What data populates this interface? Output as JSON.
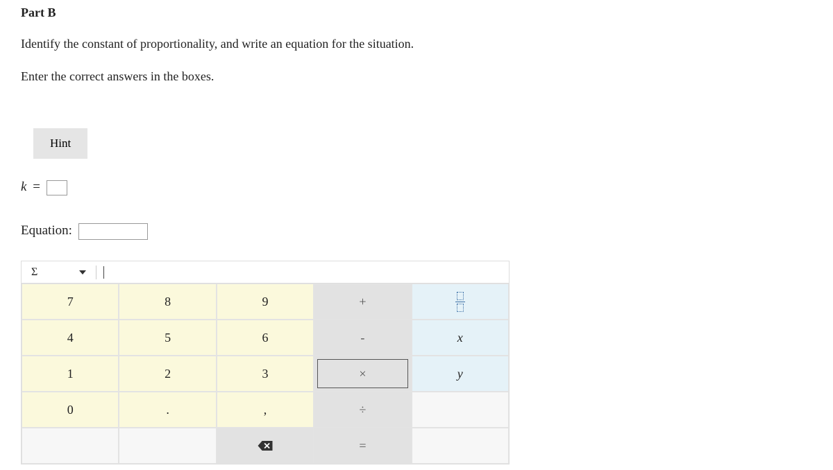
{
  "part_title": "Part B",
  "instruction1": "Identify the constant of proportionality, and write an equation for the situation.",
  "instruction2": "Enter the correct answers in the boxes.",
  "hint_label": "Hint",
  "k_row": {
    "var": "k",
    "eq": "="
  },
  "equation_label": "Equation:",
  "toolbar": {
    "sigma": "Σ"
  },
  "keys": {
    "r1": {
      "c1": "7",
      "c2": "8",
      "c3": "9",
      "c4": "+",
      "c5_name": "fraction-key"
    },
    "r2": {
      "c1": "4",
      "c2": "5",
      "c3": "6",
      "c4": "-",
      "c5": "x"
    },
    "r3": {
      "c1": "1",
      "c2": "2",
      "c3": "3",
      "c4": "×",
      "c5": "y"
    },
    "r4": {
      "c1": "0",
      "c2": ".",
      "c3": ",",
      "c4": "÷"
    },
    "r5": {
      "c3_name": "backspace-key",
      "c4": "="
    }
  }
}
